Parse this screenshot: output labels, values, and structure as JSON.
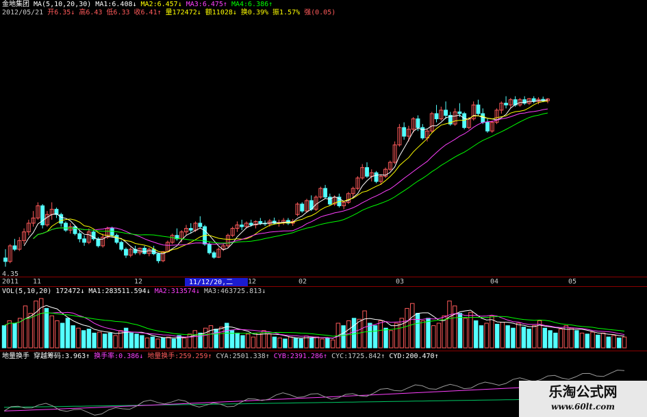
{
  "colors": {
    "up": "#ff5a5a",
    "down": "#54ffff",
    "ma1": "#ffffff",
    "ma2": "#ffff00",
    "ma3": "#ff40ff",
    "ma4": "#00ff00",
    "text": "#dddddd",
    "label": "#ffffff",
    "dim": "#bbbbbb"
  },
  "header": {
    "stock_name": "金地集团",
    "ma_params": "MA(5,10,20,30)",
    "ma1": "MA1:6.408↓",
    "ma2": "MA2:6.457↓",
    "ma3": "MA3:6.475↑",
    "ma4": "MA4:6.386↑",
    "date": "2012/05/21",
    "open": "开6.35↓",
    "high": "高6.43",
    "low": "低6.33",
    "close": "收6.41↑",
    "volume": "量172472↓",
    "amount": "额11028↓",
    "turnover": "换0.39%",
    "amplitude": "振1.57%",
    "strength": "强(0.05)"
  },
  "vol_header": {
    "params": "VOL(5,10,20)",
    "vol": "172472↓",
    "ma1": "MA1:283511.594↓",
    "ma2": "MA2:313574↓",
    "ma3": "MA3:463725.813↓"
  },
  "ind_header": {
    "name": "地量换手",
    "pass": "穿越筹码:3.963↑",
    "hsl": "换手率:0.386↓",
    "dlhs": "地量换手:259.259↑",
    "cya": "CYA:2501.338↑",
    "cyb": "CYB:2391.286↑",
    "cyc": "CYC:1725.842↑",
    "cyd": "CYD:200.470↑"
  },
  "price_min_label": "4.35",
  "cursor_date": "11/12/20,二",
  "x_labels": [
    "2011",
    "11",
    "12",
    "12",
    "02",
    "03",
    "04",
    "05"
  ],
  "watermark": {
    "title": "乐淘公式网",
    "url": "www.60lt.com"
  },
  "chart_data": {
    "type": "candlestick",
    "x_axis": [
      "2011",
      "11",
      "12",
      "02",
      "03",
      "04",
      "05"
    ],
    "price_range": [
      4.35,
      7.2
    ],
    "ohlc": [
      [
        4.7,
        4.95,
        4.45,
        4.6
      ],
      [
        4.6,
        5.1,
        4.55,
        5.05
      ],
      [
        5.05,
        5.25,
        4.9,
        4.95
      ],
      [
        4.95,
        5.3,
        4.9,
        5.2
      ],
      [
        5.2,
        5.55,
        5.1,
        5.45
      ],
      [
        5.45,
        5.8,
        5.35,
        5.7
      ],
      [
        5.7,
        6.05,
        5.6,
        5.85
      ],
      [
        5.85,
        6.3,
        5.8,
        6.2
      ],
      [
        6.2,
        6.25,
        5.55,
        5.65
      ],
      [
        5.65,
        6.05,
        5.6,
        5.95
      ],
      [
        5.95,
        6.3,
        5.8,
        6.1
      ],
      [
        6.1,
        6.15,
        5.85,
        5.95
      ],
      [
        5.95,
        6.0,
        5.6,
        5.7
      ],
      [
        5.7,
        5.75,
        5.45,
        5.5
      ],
      [
        5.5,
        5.7,
        5.4,
        5.6
      ],
      [
        5.6,
        5.65,
        5.35,
        5.4
      ],
      [
        5.4,
        5.5,
        5.15,
        5.25
      ],
      [
        5.25,
        5.35,
        5.05,
        5.15
      ],
      [
        5.15,
        5.55,
        5.1,
        5.45
      ],
      [
        5.45,
        5.5,
        5.2,
        5.25
      ],
      [
        5.25,
        5.3,
        5.0,
        5.05
      ],
      [
        5.05,
        5.4,
        5.0,
        5.3
      ],
      [
        5.3,
        5.6,
        5.25,
        5.55
      ],
      [
        5.55,
        5.6,
        5.3,
        5.35
      ],
      [
        5.35,
        5.4,
        5.1,
        5.15
      ],
      [
        5.15,
        5.2,
        4.9,
        4.95
      ],
      [
        4.95,
        5.0,
        4.7,
        4.78
      ],
      [
        4.78,
        5.0,
        4.72,
        4.95
      ],
      [
        4.95,
        5.05,
        4.8,
        4.85
      ],
      [
        4.85,
        5.0,
        4.78,
        4.98
      ],
      [
        4.98,
        5.05,
        4.8,
        4.83
      ],
      [
        4.83,
        5.0,
        4.75,
        4.95
      ],
      [
        4.95,
        5.05,
        4.78,
        4.82
      ],
      [
        4.82,
        4.85,
        4.55,
        4.62
      ],
      [
        4.62,
        4.9,
        4.58,
        4.88
      ],
      [
        4.88,
        5.2,
        4.85,
        5.15
      ],
      [
        5.15,
        5.4,
        5.1,
        5.35
      ],
      [
        5.35,
        5.55,
        5.2,
        5.25
      ],
      [
        5.25,
        5.5,
        5.15,
        5.45
      ],
      [
        5.45,
        5.65,
        5.35,
        5.55
      ],
      [
        5.55,
        5.7,
        5.4,
        5.5
      ],
      [
        5.5,
        5.75,
        5.45,
        5.7
      ],
      [
        5.7,
        5.9,
        5.55,
        5.6
      ],
      [
        5.6,
        5.65,
        5.05,
        5.1
      ],
      [
        5.1,
        5.15,
        4.8,
        4.85
      ],
      [
        4.85,
        4.9,
        4.68,
        4.72
      ],
      [
        4.72,
        5.0,
        4.7,
        4.95
      ],
      [
        4.95,
        5.1,
        4.9,
        5.05
      ],
      [
        5.05,
        5.4,
        5.0,
        5.35
      ],
      [
        5.35,
        5.6,
        5.3,
        5.55
      ],
      [
        5.55,
        5.75,
        5.45,
        5.65
      ],
      [
        5.65,
        5.8,
        5.5,
        5.6
      ],
      [
        5.6,
        5.75,
        5.55,
        5.7
      ],
      [
        5.7,
        5.8,
        5.6,
        5.65
      ],
      [
        5.65,
        5.78,
        5.55,
        5.75
      ],
      [
        5.75,
        5.85,
        5.65,
        5.7
      ],
      [
        5.7,
        5.78,
        5.62,
        5.68
      ],
      [
        5.68,
        5.82,
        5.6,
        5.76
      ],
      [
        5.76,
        5.86,
        5.66,
        5.7
      ],
      [
        5.7,
        5.8,
        5.6,
        5.72
      ],
      [
        5.72,
        5.85,
        5.65,
        5.78
      ],
      [
        5.78,
        5.85,
        5.65,
        5.7
      ],
      [
        5.7,
        5.82,
        5.62,
        5.75
      ],
      [
        5.95,
        6.3,
        5.9,
        6.25
      ],
      [
        6.25,
        6.3,
        6.0,
        6.05
      ],
      [
        6.05,
        6.4,
        6.0,
        6.35
      ],
      [
        6.35,
        6.5,
        6.05,
        6.1
      ],
      [
        6.1,
        6.5,
        6.05,
        6.45
      ],
      [
        6.45,
        6.75,
        6.4,
        6.7
      ],
      [
        6.7,
        6.8,
        6.4,
        6.45
      ],
      [
        6.45,
        6.55,
        6.2,
        6.25
      ],
      [
        6.25,
        6.5,
        6.2,
        6.45
      ],
      [
        6.45,
        6.55,
        6.15,
        6.2
      ],
      [
        6.2,
        6.35,
        6.1,
        6.3
      ],
      [
        6.3,
        6.6,
        6.25,
        6.55
      ],
      [
        6.55,
        6.75,
        6.45,
        6.7
      ],
      [
        6.7,
        7.05,
        6.65,
        7.0
      ],
      [
        7.0,
        7.4,
        6.95,
        7.3
      ],
      [
        7.3,
        7.45,
        7.0,
        7.05
      ],
      [
        7.05,
        7.25,
        6.9,
        7.15
      ],
      [
        7.15,
        7.2,
        6.85,
        6.9
      ],
      [
        6.9,
        7.1,
        6.8,
        7.05
      ],
      [
        7.05,
        7.3,
        7.0,
        7.25
      ],
      [
        7.25,
        7.5,
        7.2,
        7.45
      ],
      [
        7.45,
        8.05,
        7.4,
        7.95
      ],
      [
        7.95,
        8.55,
        7.9,
        8.45
      ],
      [
        8.45,
        8.6,
        8.1,
        8.2
      ],
      [
        8.2,
        8.5,
        8.05,
        8.4
      ],
      [
        8.4,
        8.75,
        8.3,
        8.7
      ],
      [
        8.7,
        8.8,
        8.35,
        8.45
      ],
      [
        8.45,
        8.55,
        8.1,
        8.15
      ],
      [
        8.15,
        8.4,
        8.05,
        8.35
      ],
      [
        8.35,
        8.9,
        8.3,
        8.85
      ],
      [
        8.85,
        9.1,
        8.6,
        8.7
      ],
      [
        8.7,
        9.05,
        8.65,
        8.95
      ],
      [
        8.95,
        9.2,
        8.7,
        8.8
      ],
      [
        8.8,
        8.9,
        8.5,
        8.55
      ],
      [
        8.55,
        9.0,
        8.5,
        8.9
      ],
      [
        8.9,
        9.15,
        8.75,
        8.85
      ],
      [
        8.85,
        8.9,
        8.4,
        8.45
      ],
      [
        8.45,
        8.75,
        8.4,
        8.7
      ],
      [
        8.7,
        9.2,
        8.65,
        9.1
      ],
      [
        9.1,
        9.25,
        8.8,
        8.85
      ],
      [
        8.85,
        9.0,
        8.55,
        8.6
      ],
      [
        8.6,
        8.7,
        8.3,
        8.35
      ],
      [
        8.35,
        8.65,
        8.3,
        8.6
      ],
      [
        8.6,
        9.0,
        8.55,
        8.95
      ],
      [
        8.95,
        9.2,
        8.85,
        9.15
      ],
      [
        9.15,
        9.35,
        9.0,
        9.1
      ],
      [
        9.1,
        9.3,
        9.0,
        9.25
      ],
      [
        9.25,
        9.35,
        9.05,
        9.1
      ],
      [
        9.1,
        9.3,
        9.05,
        9.25
      ],
      [
        9.25,
        9.35,
        9.1,
        9.15
      ],
      [
        9.15,
        9.3,
        9.1,
        9.28
      ],
      [
        9.28,
        9.35,
        9.15,
        9.2
      ],
      [
        9.2,
        9.32,
        9.12,
        9.26
      ],
      [
        9.26,
        9.34,
        9.18,
        9.22
      ],
      [
        9.22,
        9.3,
        9.15,
        9.27
      ]
    ],
    "volume_rel": [
      0.45,
      0.55,
      0.5,
      0.6,
      0.85,
      0.7,
      0.95,
      1.0,
      0.8,
      0.65,
      0.55,
      0.5,
      0.6,
      0.45,
      0.4,
      0.35,
      0.38,
      0.3,
      0.32,
      0.28,
      0.3,
      0.25,
      0.35,
      0.4,
      0.3,
      0.28,
      0.25,
      0.2,
      0.22,
      0.18,
      0.2,
      0.22,
      0.18,
      0.25,
      0.2,
      0.28,
      0.35,
      0.3,
      0.4,
      0.45,
      0.38,
      0.42,
      0.5,
      0.35,
      0.3,
      0.25,
      0.28,
      0.22,
      0.3,
      0.35,
      0.28,
      0.22,
      0.2,
      0.18,
      0.22,
      0.2,
      0.18,
      0.24,
      0.2,
      0.22,
      0.18,
      0.2,
      0.16,
      0.5,
      0.45,
      0.55,
      0.6,
      0.58,
      0.75,
      0.5,
      0.45,
      0.55,
      0.4,
      0.35,
      0.5,
      0.6,
      0.8,
      0.9,
      0.7,
      0.55,
      0.6,
      0.45,
      0.5,
      0.65,
      0.95,
      0.85,
      0.7,
      0.6,
      0.72,
      0.55,
      0.45,
      0.5,
      0.65,
      0.48,
      0.52,
      0.45,
      0.4,
      0.5,
      0.42,
      0.38,
      0.45,
      0.55,
      0.4,
      0.35,
      0.3,
      0.38,
      0.45,
      0.4,
      0.35,
      0.3,
      0.28,
      0.32,
      0.26,
      0.3,
      0.22,
      0.25,
      0.2,
      0.22
    ]
  }
}
